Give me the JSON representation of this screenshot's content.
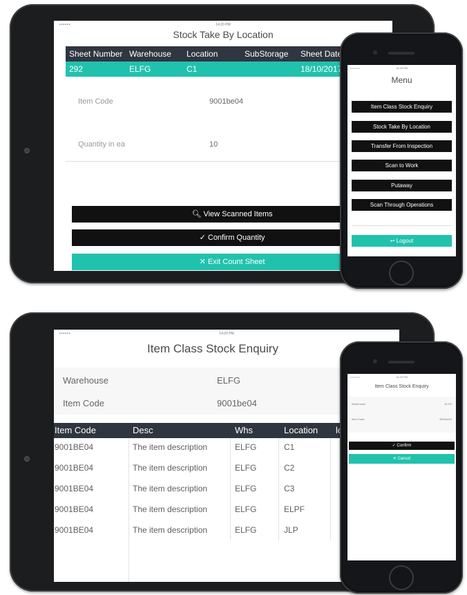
{
  "top": {
    "status": {
      "dots": "••••••",
      "time": "14:20 PM"
    },
    "title": "Stock Take By Location",
    "table": {
      "headers": [
        "Sheet Number",
        "Warehouse",
        "Location",
        "SubStorage",
        "Sheet Date"
      ],
      "row": [
        "292",
        "ELFG",
        "C1",
        "",
        "18/10/2017"
      ]
    },
    "item_code_label": "Item Code",
    "item_code_value": "9001be04",
    "quantity_label": "Quantity in ea",
    "quantity_value": "10",
    "view_scanned_label": "View Scanned Items",
    "confirm_quantity_label": "Confirm Quantity",
    "exit_count_label": "Exit Count Sheet",
    "colors": {
      "teal": "#21c2ad",
      "header": "#2f3640",
      "black": "#111111"
    }
  },
  "top_phone": {
    "status": {
      "dots": "••••••",
      "time": "14:20 PM"
    },
    "title": "Menu",
    "items": [
      "Item Class Stock Enquiry",
      "Stock Take By Location",
      "Transfer From Inspection",
      "Scan to Work",
      "Putaway",
      "Scan Through Operations"
    ],
    "logout_label": "Logout"
  },
  "bottom": {
    "status": {
      "dots": "••••••",
      "time": "14:20 PM"
    },
    "title": "Item Class Stock Enquiry",
    "warehouse_label": "Warehouse",
    "warehouse_value": "ELFG",
    "item_code_label": "Item Code",
    "item_code_value": "9001be04",
    "table": {
      "headers": [
        "Item Code",
        "Desc",
        "Whs",
        "Location",
        "lo"
      ],
      "rows": [
        [
          "9001BE04",
          "The item description",
          "ELFG",
          "C1"
        ],
        [
          "9001BE04",
          "The item description",
          "ELFG",
          "C2"
        ],
        [
          "9001BE04",
          "The item description",
          "ELFG",
          "C3"
        ],
        [
          "9001BE04",
          "The item description",
          "ELFG",
          "ELPF"
        ],
        [
          "9001BE04",
          "The item description",
          "ELFG",
          "JLP"
        ]
      ]
    }
  },
  "bottom_phone": {
    "status": {
      "dots": "••••••",
      "time": "14:20 PM"
    },
    "title": "Item Class Stock Enquiry",
    "warehouse_label": "Warehouse",
    "warehouse_value": "ELFG",
    "item_code_label": "Item Code",
    "item_code_value": "9001be04",
    "confirm_label": "Confirm",
    "cancel_label": "Cancel"
  }
}
